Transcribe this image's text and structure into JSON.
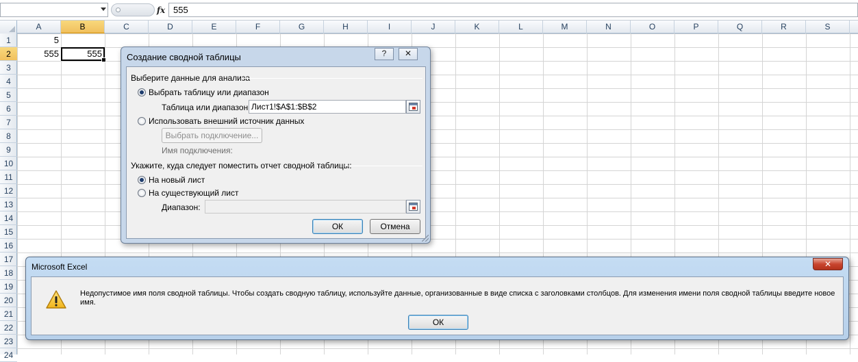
{
  "formula_bar": {
    "name_box": "",
    "fx": "fx",
    "value": "555"
  },
  "grid": {
    "columns": [
      "A",
      "B",
      "C",
      "D",
      "E",
      "F",
      "G",
      "H",
      "I",
      "J",
      "K",
      "L",
      "M",
      "N",
      "O",
      "P",
      "Q",
      "R",
      "S"
    ],
    "selected_column": "B",
    "rows": [
      "1",
      "2",
      "3",
      "4",
      "5",
      "6",
      "7",
      "8",
      "9",
      "10",
      "11",
      "12",
      "13",
      "14",
      "15",
      "16",
      "17",
      "18",
      "19",
      "20",
      "21",
      "22",
      "23",
      "24"
    ],
    "selected_row": "2",
    "cells": {
      "A1": "5",
      "A2": "555",
      "B2": "555"
    }
  },
  "pivot_dialog": {
    "title": "Создание сводной таблицы",
    "help_icon": "?",
    "close_icon": "✕",
    "section_data": "Выберите данные для анализа",
    "opt_table_range": "Выбрать таблицу или диапазон",
    "table_range_label": "Таблица или диапазон:",
    "table_range_value": "Лист1!$A$1:$B$2",
    "opt_external": "Использовать внешний источник данных",
    "choose_connection": "Выбрать подключение...",
    "connection_name_label": "Имя подключения:",
    "section_location": "Укажите, куда следует поместить отчет сводной таблицы:",
    "opt_new_sheet": "На новый лист",
    "opt_existing_sheet": "На существующий лист",
    "location_label": "Диапазон:",
    "location_value": "",
    "ok": "ОК",
    "cancel": "Отмена"
  },
  "message_box": {
    "title": "Microsoft Excel",
    "close_icon": "✕",
    "text": "Недопустимое имя поля сводной таблицы. Чтобы создать сводную таблицу, используйте данные, организованные в виде списка с заголовками столбцов. Для изменения имени поля сводной таблицы введите новое имя.",
    "ok": "ОК"
  }
}
